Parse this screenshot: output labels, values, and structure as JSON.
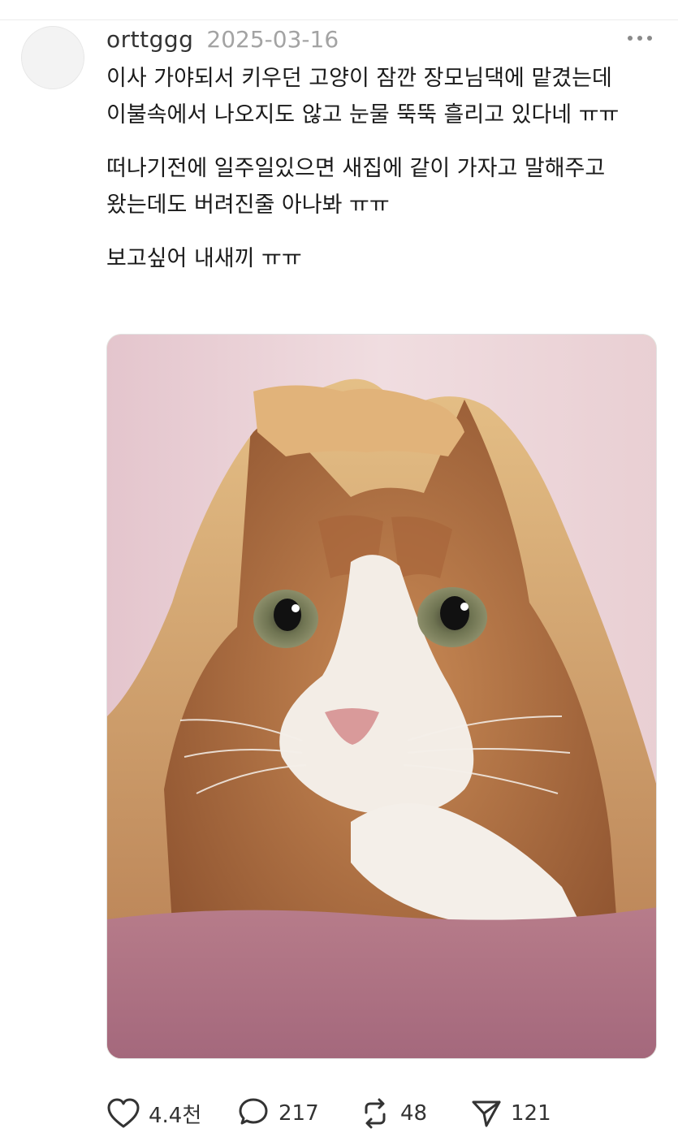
{
  "post": {
    "username": "orttggg",
    "date": "2025-03-16",
    "paragraphs": [
      "이사 가야되서 키우던 고양이 잠깐 장모님댁에 맡겼는데 이불속에서 나오지도 않고 눈물 뚝뚝 흘리고 있다네 ㅠㅠ",
      "떠나기전에 일주일있으면 새집에 같이 가자고 말해주고 왔는데도 버려진줄 아나봐 ㅠㅠ",
      "보고싶어 내새끼 ㅠㅠ"
    ],
    "image": {
      "subject": "cat-under-blanket"
    }
  },
  "actions": {
    "like_count": "4.4천",
    "comment_count": "217",
    "repost_count": "48",
    "share_count": "121"
  },
  "icons": {
    "more": "more-dots-icon",
    "like": "heart-icon",
    "comment": "speech-bubble-icon",
    "repost": "repost-arrows-icon",
    "share": "send-icon"
  },
  "colors": {
    "username": "#333333",
    "date": "#a3a3a3",
    "text": "#1a1a1a",
    "icon": "#333333"
  }
}
